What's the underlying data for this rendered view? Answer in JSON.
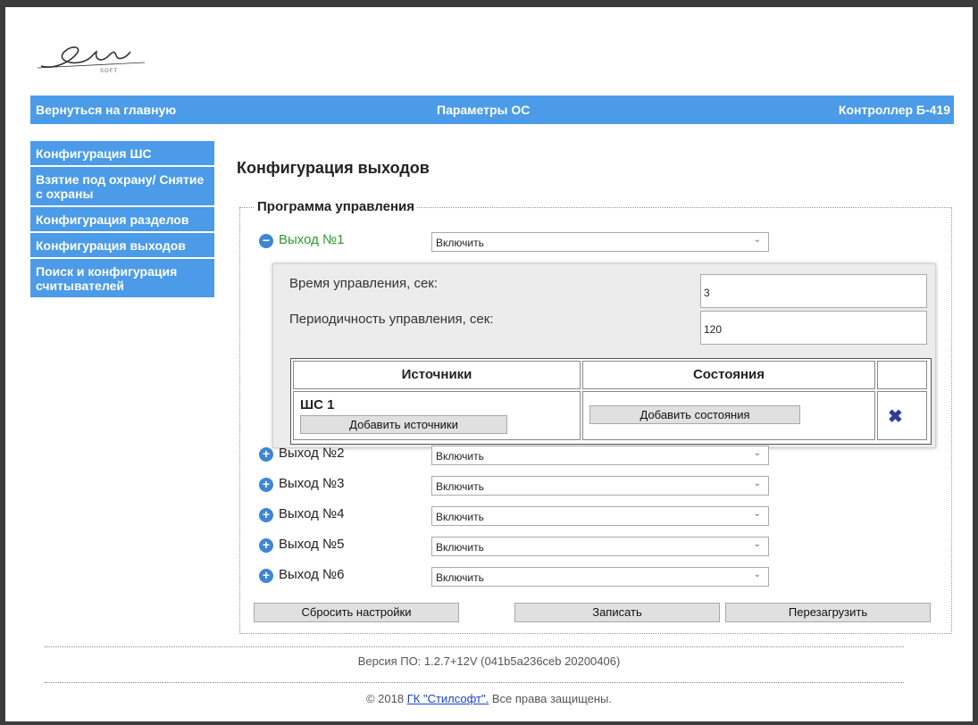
{
  "logo": {
    "text": "Stil",
    "subtext": "SOFT"
  },
  "topbar": {
    "back": "Вернуться на главную",
    "title": "Параметры ОС",
    "device": "Контроллер Б-419"
  },
  "sidebar": {
    "items": [
      {
        "label": "Конфигурация ШС"
      },
      {
        "label": "Взятие под охрану/ Снятие с охраны"
      },
      {
        "label": "Конфигурация разделов"
      },
      {
        "label": "Конфигурация выходов"
      },
      {
        "label": "Поиск и конфигурация считывателей"
      }
    ]
  },
  "main": {
    "heading": "Конфигурация выходов",
    "legend": "Программа управления",
    "outputs": [
      {
        "label": "Выход №1",
        "value": "Включить",
        "expanded": true
      },
      {
        "label": "Выход №2",
        "value": "Включить",
        "expanded": false
      },
      {
        "label": "Выход №3",
        "value": "Включить",
        "expanded": false
      },
      {
        "label": "Выход №4",
        "value": "Включить",
        "expanded": false
      },
      {
        "label": "Выход №5",
        "value": "Включить",
        "expanded": false
      },
      {
        "label": "Выход №6",
        "value": "Включить",
        "expanded": false
      }
    ],
    "panel": {
      "time_label": "Время управления, сек:",
      "time_value": "3",
      "period_label": "Периодичность управления, сек:",
      "period_value": "120",
      "col_sources": "Источники",
      "col_states": "Состояния",
      "source_name": "ШС 1",
      "add_sources": "Добавить источники",
      "add_states": "Добавить состояния"
    },
    "buttons": {
      "reset": "Сбросить настройки",
      "write": "Записать",
      "reboot": "Перезагрузить"
    }
  },
  "footer": {
    "version": "Версия ПО: 1.2.7+12V (041b5a236ceb 20200406)",
    "copy_prefix": "© 2018 ",
    "company": "ГК \"Стилсофт\".",
    "copy_suffix": " Все права защищены."
  },
  "colors": {
    "accent": "#4b9be8",
    "output_active": "#2e9a2e",
    "delete_icon": "#2d3e9a",
    "link": "#1a3fd1"
  },
  "icons": {
    "expand": "plus-circle-icon",
    "collapse": "minus-circle-icon",
    "delete": "x-icon",
    "select": "chevron-down-icon"
  }
}
